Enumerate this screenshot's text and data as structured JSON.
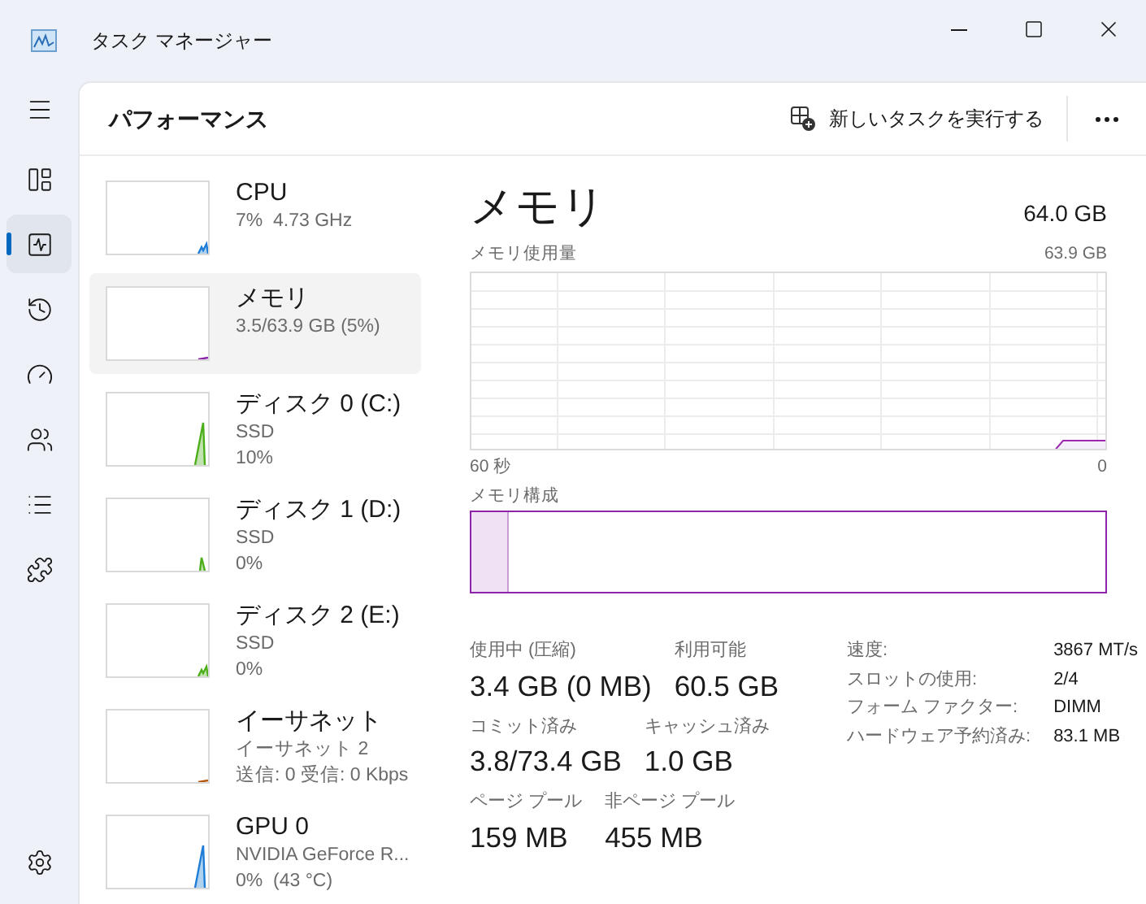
{
  "window": {
    "title": "タスク マネージャー"
  },
  "nav": [
    {
      "kind": "menu",
      "selected": false
    },
    {
      "kind": "processes",
      "selected": false
    },
    {
      "kind": "performance",
      "selected": true
    },
    {
      "kind": "history",
      "selected": false
    },
    {
      "kind": "startup",
      "selected": false
    },
    {
      "kind": "users",
      "selected": false
    },
    {
      "kind": "details",
      "selected": false
    },
    {
      "kind": "services",
      "selected": false
    }
  ],
  "page_title": "パフォーマンス",
  "run_task": "新しいタスクを実行する",
  "resources": [
    {
      "name": "CPU",
      "lines": [
        "7%  4.73 GHz"
      ],
      "color": "#1e7dd6",
      "selected": false
    },
    {
      "name": "メモリ",
      "lines": [
        "3.5/63.9 GB (5%)"
      ],
      "color": "#8e24aa",
      "selected": true
    },
    {
      "name": "ディスク 0 (C:)",
      "lines": [
        "SSD",
        "10%"
      ],
      "color": "#4caf1a",
      "selected": false
    },
    {
      "name": "ディスク 1 (D:)",
      "lines": [
        "SSD",
        "0%"
      ],
      "color": "#4caf1a",
      "selected": false
    },
    {
      "name": "ディスク 2 (E:)",
      "lines": [
        "SSD",
        "0%"
      ],
      "color": "#4caf1a",
      "selected": false
    },
    {
      "name": "イーサネット",
      "lines": [
        "イーサネット 2",
        "送信: 0 受信: 0 Kbps"
      ],
      "color": "#b5570d",
      "selected": false
    },
    {
      "name": "GPU 0",
      "lines": [
        "NVIDIA GeForce R...",
        "0%  (43 °C)"
      ],
      "color": "#1e7dd6",
      "selected": false
    }
  ],
  "detail": {
    "title": "メモリ",
    "total": "64.0 GB",
    "usage_label": "メモリ使用量",
    "usage_max": "63.9 GB",
    "time_start": "60 秒",
    "time_end": "0",
    "composition": {
      "label": "メモリ構成",
      "level": 0.06
    },
    "stats": [
      [
        {
          "label": "使用中 (圧縮)",
          "value": "3.4 GB (0 MB)"
        },
        {
          "label": "利用可能",
          "value": "60.5 GB"
        }
      ],
      [
        {
          "label": "コミット済み",
          "value": "3.8/73.4 GB"
        },
        {
          "label": "キャッシュ済み",
          "value": "1.0 GB"
        }
      ],
      [
        {
          "label": "ページ プール",
          "value": "159 MB"
        },
        {
          "label": "非ページ プール",
          "value": "455 MB"
        }
      ]
    ],
    "specs": [
      {
        "label": "速度:",
        "value": "3867 MT/s"
      },
      {
        "label": "スロットの使用:",
        "value": "2/4"
      },
      {
        "label": "フォーム ファクター:",
        "value": "DIMM"
      },
      {
        "label": "ハードウェア予約済み:",
        "value": "83.1 MB"
      }
    ]
  }
}
